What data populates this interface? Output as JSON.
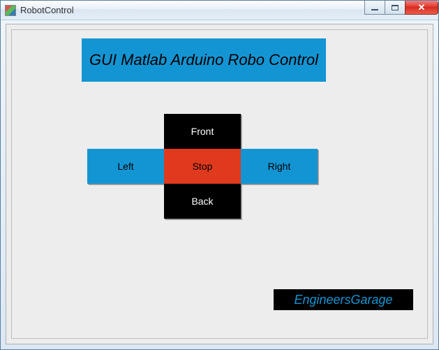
{
  "window": {
    "title": "RobotControl"
  },
  "header": {
    "title": "GUI Matlab Arduino Robo Control"
  },
  "controls": {
    "front": "Front",
    "left": "Left",
    "stop": "Stop",
    "right": "Right",
    "back": "Back"
  },
  "footer": {
    "brand": "EngineersGarage"
  },
  "colors": {
    "accent_blue": "#1495d3",
    "stop_red": "#e03a1e",
    "button_black": "#000000"
  }
}
